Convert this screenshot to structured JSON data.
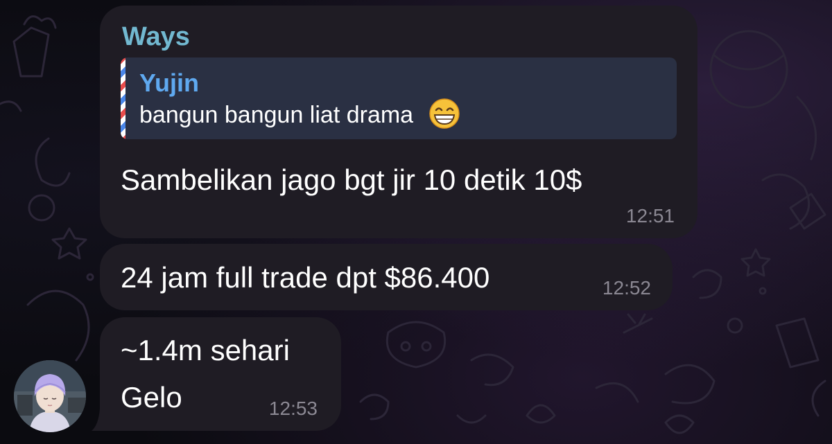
{
  "messages": [
    {
      "sender": "Ways",
      "reply": {
        "name": "Yujin",
        "text": "bangun bangun liat drama",
        "emoji": "grinning-face-icon"
      },
      "text": "Sambelikan jago bgt jir 10 detik 10$",
      "time": "12:51"
    },
    {
      "text": "24 jam full trade dpt $86.400",
      "time": "12:52"
    },
    {
      "lines": [
        "~1.4m sehari",
        "Gelo"
      ],
      "time": "12:53"
    }
  ],
  "colors": {
    "bubble": "#1f1c24",
    "sender_name": "#72b8d0",
    "reply_background": "#2a3043",
    "reply_name": "#5fa9f0",
    "timestamp": "#8b8893"
  }
}
